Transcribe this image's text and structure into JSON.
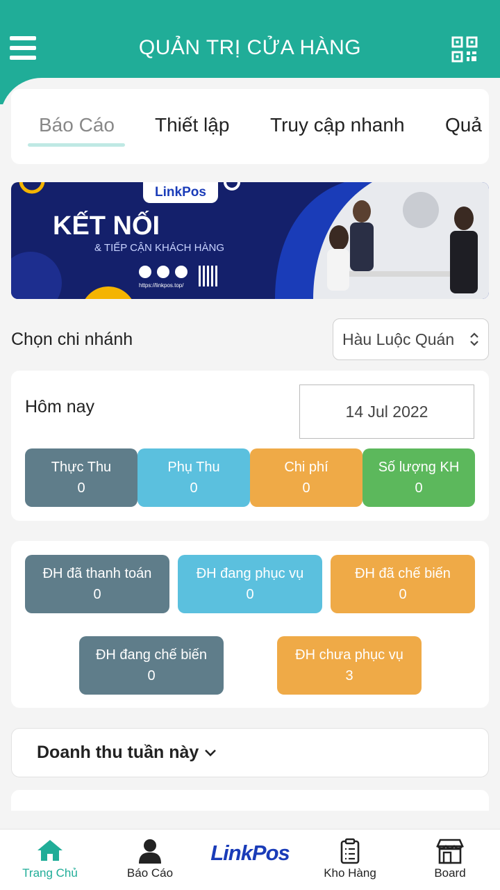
{
  "header": {
    "title": "QUẢN TRỊ CỬA HÀNG",
    "menu_icon": "menu-icon",
    "qr_icon": "qr-code-icon"
  },
  "tabs": [
    "Báo Cáo",
    "Thiết lập",
    "Truy cập nhanh",
    "Quả"
  ],
  "banner": {
    "brand": "LinkPos",
    "headline": "KẾT NỐI",
    "subline": "& TIẾP CẬN KHÁCH HÀNG",
    "url": "https://linkpos.top/"
  },
  "branch": {
    "label": "Chọn chi nhánh",
    "selected": "Hàu Luộc Quán"
  },
  "today": {
    "label": "Hôm nay",
    "date": "14 Jul 2022",
    "stats": [
      {
        "label": "Thực Thu",
        "value": "0",
        "color": "#5f7d8a"
      },
      {
        "label": "Phụ Thu",
        "value": "0",
        "color": "#5bc0de"
      },
      {
        "label": "Chi phí",
        "value": "0",
        "color": "#efaa47"
      },
      {
        "label": "Số lượng KH",
        "value": "0",
        "color": "#5cb85c"
      }
    ]
  },
  "orders": [
    {
      "label": "ĐH đã thanh toán",
      "value": "0",
      "color": "#5f7d8a"
    },
    {
      "label": "ĐH đang phục vụ",
      "value": "0",
      "color": "#5bc0de"
    },
    {
      "label": "ĐH đã chế biến",
      "value": "0",
      "color": "#efaa47"
    },
    {
      "label": "ĐH đang chế biến",
      "value": "0",
      "color": "#5f7d8a"
    },
    {
      "label": "ĐH chưa phục vụ",
      "value": "3",
      "color": "#efaa47"
    }
  ],
  "revenue": {
    "title": "Doanh thu tuần này"
  },
  "bottom_nav": [
    {
      "label": "Trang Chủ",
      "icon": "home-icon",
      "active": true
    },
    {
      "label": "Báo Cáo",
      "icon": "user-icon"
    },
    {
      "label": "LinkPos",
      "icon": "linkpos-logo"
    },
    {
      "label": "Kho Hàng",
      "icon": "clipboard-icon"
    },
    {
      "label": "Board",
      "icon": "store-icon"
    }
  ],
  "colors": {
    "primary": "#20ad98",
    "gray": "#5f7d8a",
    "blue": "#5bc0de",
    "orange": "#efaa47",
    "green": "#5cb85c"
  }
}
